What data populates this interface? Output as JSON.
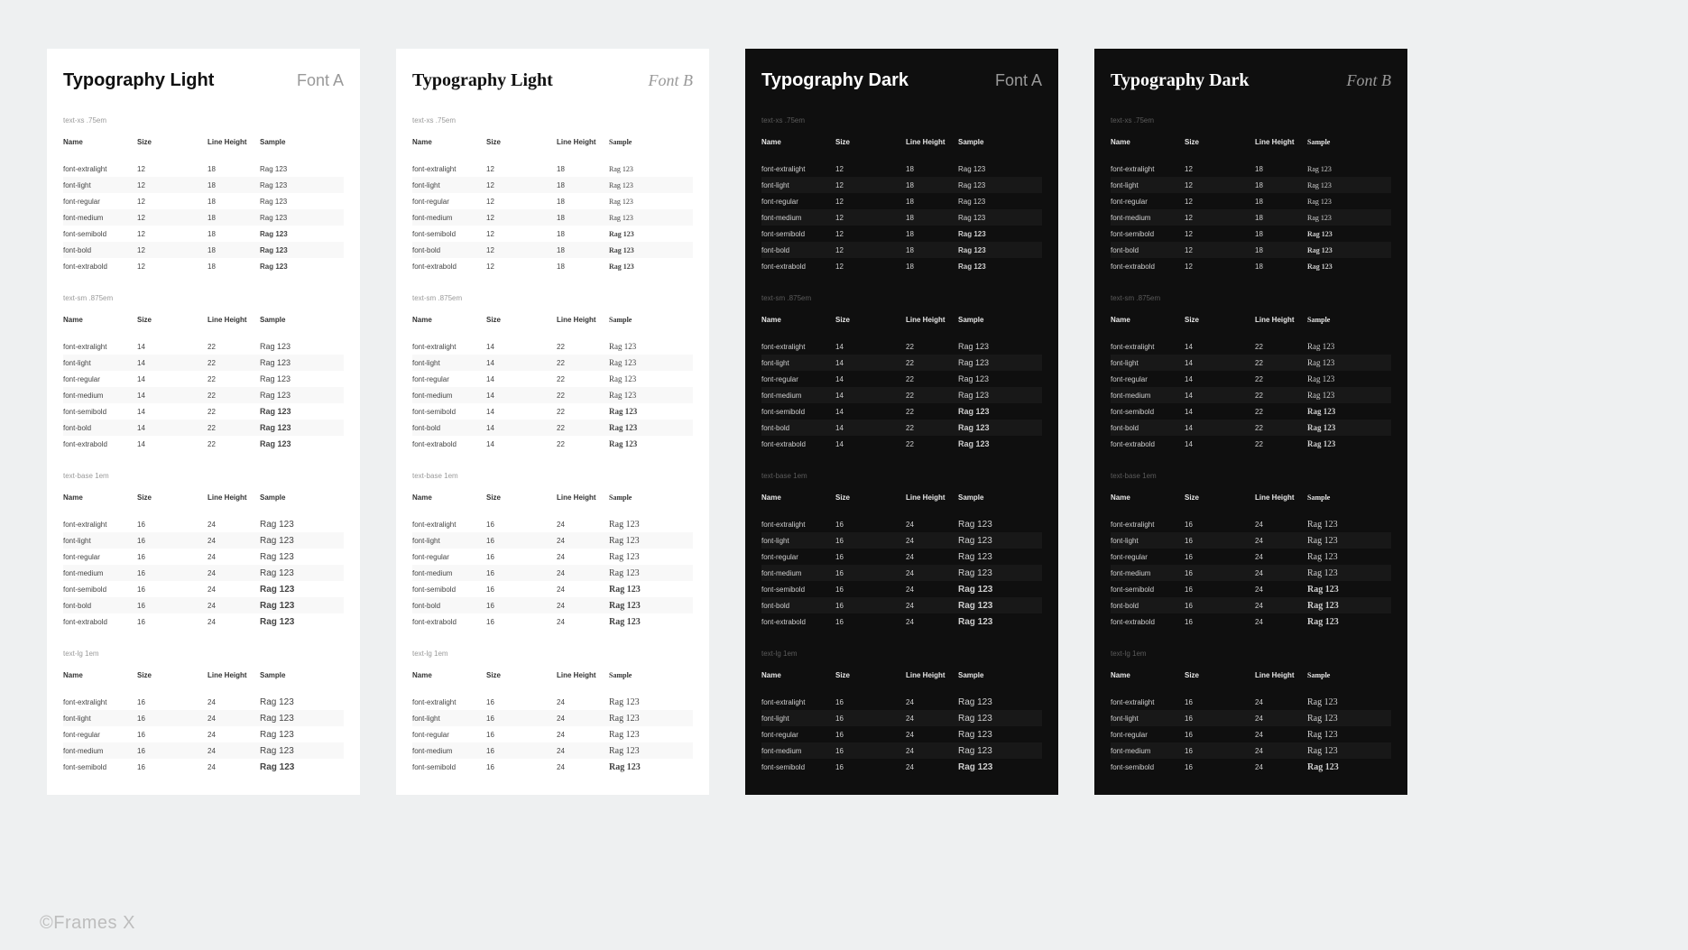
{
  "watermark": "©Frames X",
  "headers": {
    "name": "Name",
    "size": "Size",
    "lh": "Line Height",
    "sample": "Sample"
  },
  "weights": [
    {
      "key": "extralight",
      "label": "font-extralight",
      "cls": "w-extralight"
    },
    {
      "key": "light",
      "label": "font-light",
      "cls": "w-light"
    },
    {
      "key": "regular",
      "label": "font-regular",
      "cls": "w-regular"
    },
    {
      "key": "medium",
      "label": "font-medium",
      "cls": "w-medium"
    },
    {
      "key": "semibold",
      "label": "font-semibold",
      "cls": "w-semibold"
    },
    {
      "key": "bold",
      "label": "font-bold",
      "cls": "w-bold"
    },
    {
      "key": "extrabold",
      "label": "font-extrabold",
      "cls": "w-extrabold"
    }
  ],
  "sample_text": "Rag 123",
  "sections": [
    {
      "key": "xs",
      "label": "text-xs .75em",
      "size": "12",
      "lh": "18",
      "rows": 7
    },
    {
      "key": "sm",
      "label": "text-sm .875em",
      "size": "14",
      "lh": "22",
      "rows": 7
    },
    {
      "key": "base",
      "label": "text-base 1em",
      "size": "16",
      "lh": "24",
      "rows": 7
    },
    {
      "key": "lg",
      "label": "text-lg 1em",
      "size": "16",
      "lh": "24",
      "rows": 5
    }
  ],
  "panels": [
    {
      "title": "Typography Light",
      "font": "Font A",
      "theme": "light",
      "serif": false
    },
    {
      "title": "Typography Light",
      "font": "Font B",
      "theme": "light",
      "serif": true
    },
    {
      "title": "Typography Dark",
      "font": "Font A",
      "theme": "dark",
      "serif": false
    },
    {
      "title": "Typography Dark",
      "font": "Font B",
      "theme": "dark",
      "serif": true
    }
  ]
}
